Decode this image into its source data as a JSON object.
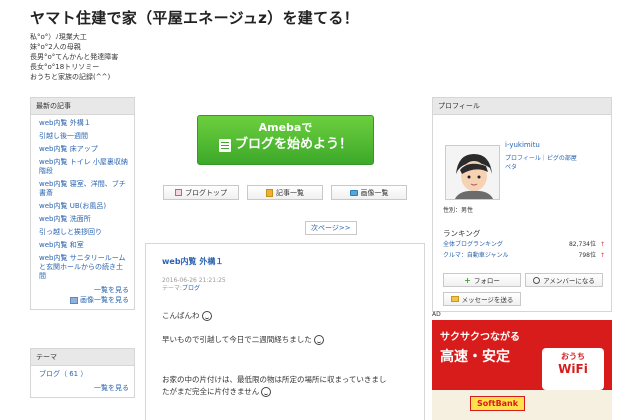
{
  "header": {
    "title": "ヤマト住建で家（平屋エネージュz）を建てる！",
    "description": [
      "私°o°）ﾉ現業大工",
      "妹°o°2人の母親",
      "長男°o°てんかんと発達障害",
      "長女°o°18トリソミー",
      "おうちと家族の記録(^^)"
    ]
  },
  "recent": {
    "heading": "最新の記事",
    "entries": [
      "web内覧 外構１",
      "引越し後一週間",
      "web内覧 床アップ",
      "web内覧 トイレ 小屋裏収納 階段",
      "web内覧 寝室、洋間、ブチ書斎",
      "web内覧 UB(お風呂)",
      "web内覧 洗面所",
      "引っ越しと挨拶回り",
      "web内覧 和室",
      "web内覧 サニタリールームと玄関ホールからの続き土間"
    ],
    "more_list": "一覧を見る",
    "more_images": "画像一覧を見る"
  },
  "theme": {
    "heading": "テーマ",
    "item": "ブログ（ 61 ）",
    "more": "一覧を見る"
  },
  "ameba": {
    "line1": "Amebaで",
    "line2": "ブログを始めよう！"
  },
  "nav": {
    "top": "ブログトップ",
    "list": "記事一覧",
    "images": "画像一覧",
    "next": "次ページ>>"
  },
  "article": {
    "title": "web内覧 外構１",
    "date": "2016-06-26 21:21:25",
    "theme_label": "テーマ:",
    "theme_value": "ブログ",
    "line1": "こんばんわ",
    "line2": "早いもので引越して今日で二週間経ちました",
    "line3": "お家の中の片付けは、最低限の物は所定の場所に収まっていきまし",
    "line4": "たがまだ完全に片付きません"
  },
  "profile": {
    "heading": "プロフィール",
    "name": "i-yukimitu",
    "links": "プロフィール｜ピグの部屋",
    "peta": "ペタ",
    "gender": "性別：男性",
    "ranking_title": "ランキング",
    "ranks": [
      {
        "label": "全体ブログランキング",
        "value": "82,734位"
      },
      {
        "label": "クルマ：自動車ジャンル",
        "value": "798位"
      }
    ],
    "follow": "フォロー",
    "amember": "アメンバーになる",
    "message": "メッセージを送る",
    "rank_arrow": "↑"
  },
  "ad": {
    "label": "AD",
    "line1": "サクサクつながる",
    "line2": "高速・安定",
    "house1": "おうち",
    "house2": "WiFi",
    "logo": "SoftBank"
  }
}
